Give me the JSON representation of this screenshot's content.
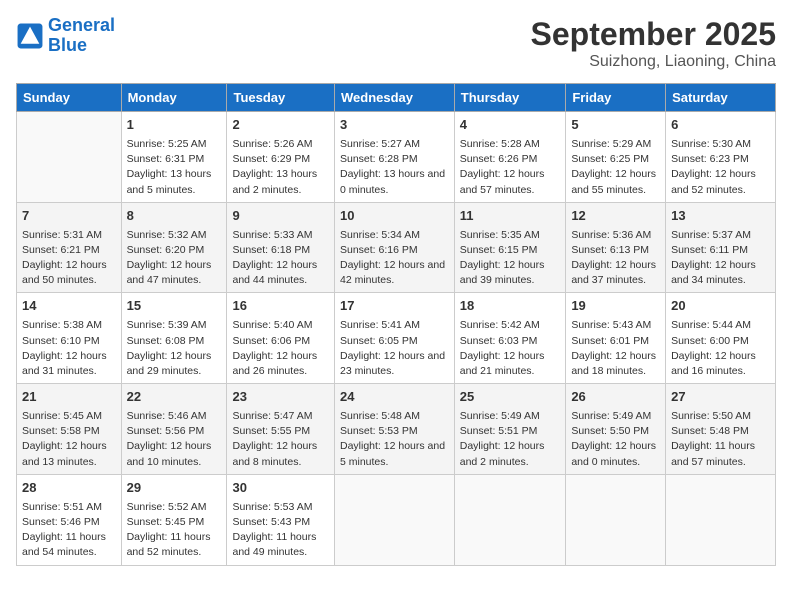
{
  "header": {
    "logo_general": "General",
    "logo_blue": "Blue",
    "month": "September 2025",
    "location": "Suizhong, Liaoning, China"
  },
  "days_of_week": [
    "Sunday",
    "Monday",
    "Tuesday",
    "Wednesday",
    "Thursday",
    "Friday",
    "Saturday"
  ],
  "weeks": [
    [
      {
        "day": "",
        "empty": true
      },
      {
        "day": "1",
        "sunrise": "Sunrise: 5:25 AM",
        "sunset": "Sunset: 6:31 PM",
        "daylight": "Daylight: 13 hours and 5 minutes."
      },
      {
        "day": "2",
        "sunrise": "Sunrise: 5:26 AM",
        "sunset": "Sunset: 6:29 PM",
        "daylight": "Daylight: 13 hours and 2 minutes."
      },
      {
        "day": "3",
        "sunrise": "Sunrise: 5:27 AM",
        "sunset": "Sunset: 6:28 PM",
        "daylight": "Daylight: 13 hours and 0 minutes."
      },
      {
        "day": "4",
        "sunrise": "Sunrise: 5:28 AM",
        "sunset": "Sunset: 6:26 PM",
        "daylight": "Daylight: 12 hours and 57 minutes."
      },
      {
        "day": "5",
        "sunrise": "Sunrise: 5:29 AM",
        "sunset": "Sunset: 6:25 PM",
        "daylight": "Daylight: 12 hours and 55 minutes."
      },
      {
        "day": "6",
        "sunrise": "Sunrise: 5:30 AM",
        "sunset": "Sunset: 6:23 PM",
        "daylight": "Daylight: 12 hours and 52 minutes."
      }
    ],
    [
      {
        "day": "7",
        "sunrise": "Sunrise: 5:31 AM",
        "sunset": "Sunset: 6:21 PM",
        "daylight": "Daylight: 12 hours and 50 minutes."
      },
      {
        "day": "8",
        "sunrise": "Sunrise: 5:32 AM",
        "sunset": "Sunset: 6:20 PM",
        "daylight": "Daylight: 12 hours and 47 minutes."
      },
      {
        "day": "9",
        "sunrise": "Sunrise: 5:33 AM",
        "sunset": "Sunset: 6:18 PM",
        "daylight": "Daylight: 12 hours and 44 minutes."
      },
      {
        "day": "10",
        "sunrise": "Sunrise: 5:34 AM",
        "sunset": "Sunset: 6:16 PM",
        "daylight": "Daylight: 12 hours and 42 minutes."
      },
      {
        "day": "11",
        "sunrise": "Sunrise: 5:35 AM",
        "sunset": "Sunset: 6:15 PM",
        "daylight": "Daylight: 12 hours and 39 minutes."
      },
      {
        "day": "12",
        "sunrise": "Sunrise: 5:36 AM",
        "sunset": "Sunset: 6:13 PM",
        "daylight": "Daylight: 12 hours and 37 minutes."
      },
      {
        "day": "13",
        "sunrise": "Sunrise: 5:37 AM",
        "sunset": "Sunset: 6:11 PM",
        "daylight": "Daylight: 12 hours and 34 minutes."
      }
    ],
    [
      {
        "day": "14",
        "sunrise": "Sunrise: 5:38 AM",
        "sunset": "Sunset: 6:10 PM",
        "daylight": "Daylight: 12 hours and 31 minutes."
      },
      {
        "day": "15",
        "sunrise": "Sunrise: 5:39 AM",
        "sunset": "Sunset: 6:08 PM",
        "daylight": "Daylight: 12 hours and 29 minutes."
      },
      {
        "day": "16",
        "sunrise": "Sunrise: 5:40 AM",
        "sunset": "Sunset: 6:06 PM",
        "daylight": "Daylight: 12 hours and 26 minutes."
      },
      {
        "day": "17",
        "sunrise": "Sunrise: 5:41 AM",
        "sunset": "Sunset: 6:05 PM",
        "daylight": "Daylight: 12 hours and 23 minutes."
      },
      {
        "day": "18",
        "sunrise": "Sunrise: 5:42 AM",
        "sunset": "Sunset: 6:03 PM",
        "daylight": "Daylight: 12 hours and 21 minutes."
      },
      {
        "day": "19",
        "sunrise": "Sunrise: 5:43 AM",
        "sunset": "Sunset: 6:01 PM",
        "daylight": "Daylight: 12 hours and 18 minutes."
      },
      {
        "day": "20",
        "sunrise": "Sunrise: 5:44 AM",
        "sunset": "Sunset: 6:00 PM",
        "daylight": "Daylight: 12 hours and 16 minutes."
      }
    ],
    [
      {
        "day": "21",
        "sunrise": "Sunrise: 5:45 AM",
        "sunset": "Sunset: 5:58 PM",
        "daylight": "Daylight: 12 hours and 13 minutes."
      },
      {
        "day": "22",
        "sunrise": "Sunrise: 5:46 AM",
        "sunset": "Sunset: 5:56 PM",
        "daylight": "Daylight: 12 hours and 10 minutes."
      },
      {
        "day": "23",
        "sunrise": "Sunrise: 5:47 AM",
        "sunset": "Sunset: 5:55 PM",
        "daylight": "Daylight: 12 hours and 8 minutes."
      },
      {
        "day": "24",
        "sunrise": "Sunrise: 5:48 AM",
        "sunset": "Sunset: 5:53 PM",
        "daylight": "Daylight: 12 hours and 5 minutes."
      },
      {
        "day": "25",
        "sunrise": "Sunrise: 5:49 AM",
        "sunset": "Sunset: 5:51 PM",
        "daylight": "Daylight: 12 hours and 2 minutes."
      },
      {
        "day": "26",
        "sunrise": "Sunrise: 5:49 AM",
        "sunset": "Sunset: 5:50 PM",
        "daylight": "Daylight: 12 hours and 0 minutes."
      },
      {
        "day": "27",
        "sunrise": "Sunrise: 5:50 AM",
        "sunset": "Sunset: 5:48 PM",
        "daylight": "Daylight: 11 hours and 57 minutes."
      }
    ],
    [
      {
        "day": "28",
        "sunrise": "Sunrise: 5:51 AM",
        "sunset": "Sunset: 5:46 PM",
        "daylight": "Daylight: 11 hours and 54 minutes."
      },
      {
        "day": "29",
        "sunrise": "Sunrise: 5:52 AM",
        "sunset": "Sunset: 5:45 PM",
        "daylight": "Daylight: 11 hours and 52 minutes."
      },
      {
        "day": "30",
        "sunrise": "Sunrise: 5:53 AM",
        "sunset": "Sunset: 5:43 PM",
        "daylight": "Daylight: 11 hours and 49 minutes."
      },
      {
        "day": "",
        "empty": true
      },
      {
        "day": "",
        "empty": true
      },
      {
        "day": "",
        "empty": true
      },
      {
        "day": "",
        "empty": true
      }
    ]
  ]
}
